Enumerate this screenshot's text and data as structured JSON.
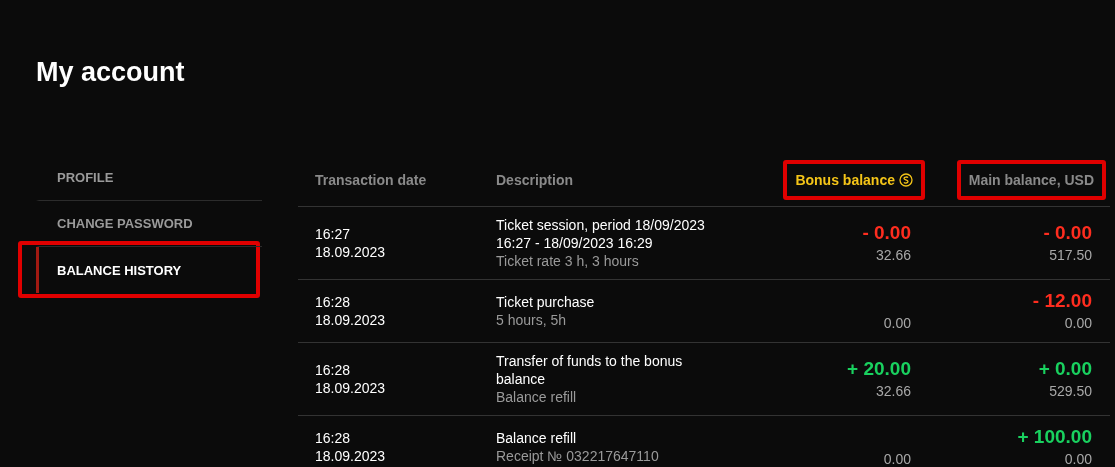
{
  "page_title": "My account",
  "sidebar": {
    "items": [
      {
        "label": "PROFILE",
        "selected": false,
        "highlighted": false
      },
      {
        "label": "CHANGE PASSWORD",
        "selected": false,
        "highlighted": false
      },
      {
        "label": "BALANCE HISTORY",
        "selected": true,
        "highlighted": true
      }
    ]
  },
  "table": {
    "columns": [
      {
        "label": "Transaction date",
        "kind": "text",
        "highlighted": false
      },
      {
        "label": "Description",
        "kind": "text",
        "highlighted": false
      },
      {
        "label": "Bonus balance",
        "kind": "bonus",
        "highlighted": true
      },
      {
        "label": "Main balance, USD",
        "kind": "main",
        "highlighted": true
      }
    ],
    "rows": [
      {
        "time": "16:27",
        "date": "18.09.2023",
        "description": "Ticket session, period 18/09/2023 16:27 - 18/09/2023 16:29",
        "detail": "Ticket rate 3 h, 3 hours",
        "bonus": {
          "change": "- 0.00",
          "kind": "debit",
          "balance": "32.66"
        },
        "main": {
          "change": "- 0.00",
          "kind": "debit",
          "balance": "517.50"
        }
      },
      {
        "time": "16:28",
        "date": "18.09.2023",
        "description": "Ticket purchase",
        "detail": "5 hours, 5h",
        "bonus": {
          "balance": "0.00"
        },
        "main": {
          "change": "- 12.00",
          "kind": "debit",
          "balance": "0.00"
        }
      },
      {
        "time": "16:28",
        "date": "18.09.2023",
        "description": "Transfer of funds to the bonus balance",
        "detail": "Balance refill",
        "bonus": {
          "change": "+ 20.00",
          "kind": "credit",
          "balance": "32.66"
        },
        "main": {
          "change": "+ 0.00",
          "kind": "credit",
          "balance": "529.50"
        }
      },
      {
        "time": "16:28",
        "date": "18.09.2023",
        "description": "Balance refill",
        "detail": "Receipt № 032217647110",
        "bonus": {
          "balance": "0.00"
        },
        "main": {
          "change": "+ 100.00",
          "kind": "credit",
          "balance": "0.00"
        }
      }
    ]
  }
}
